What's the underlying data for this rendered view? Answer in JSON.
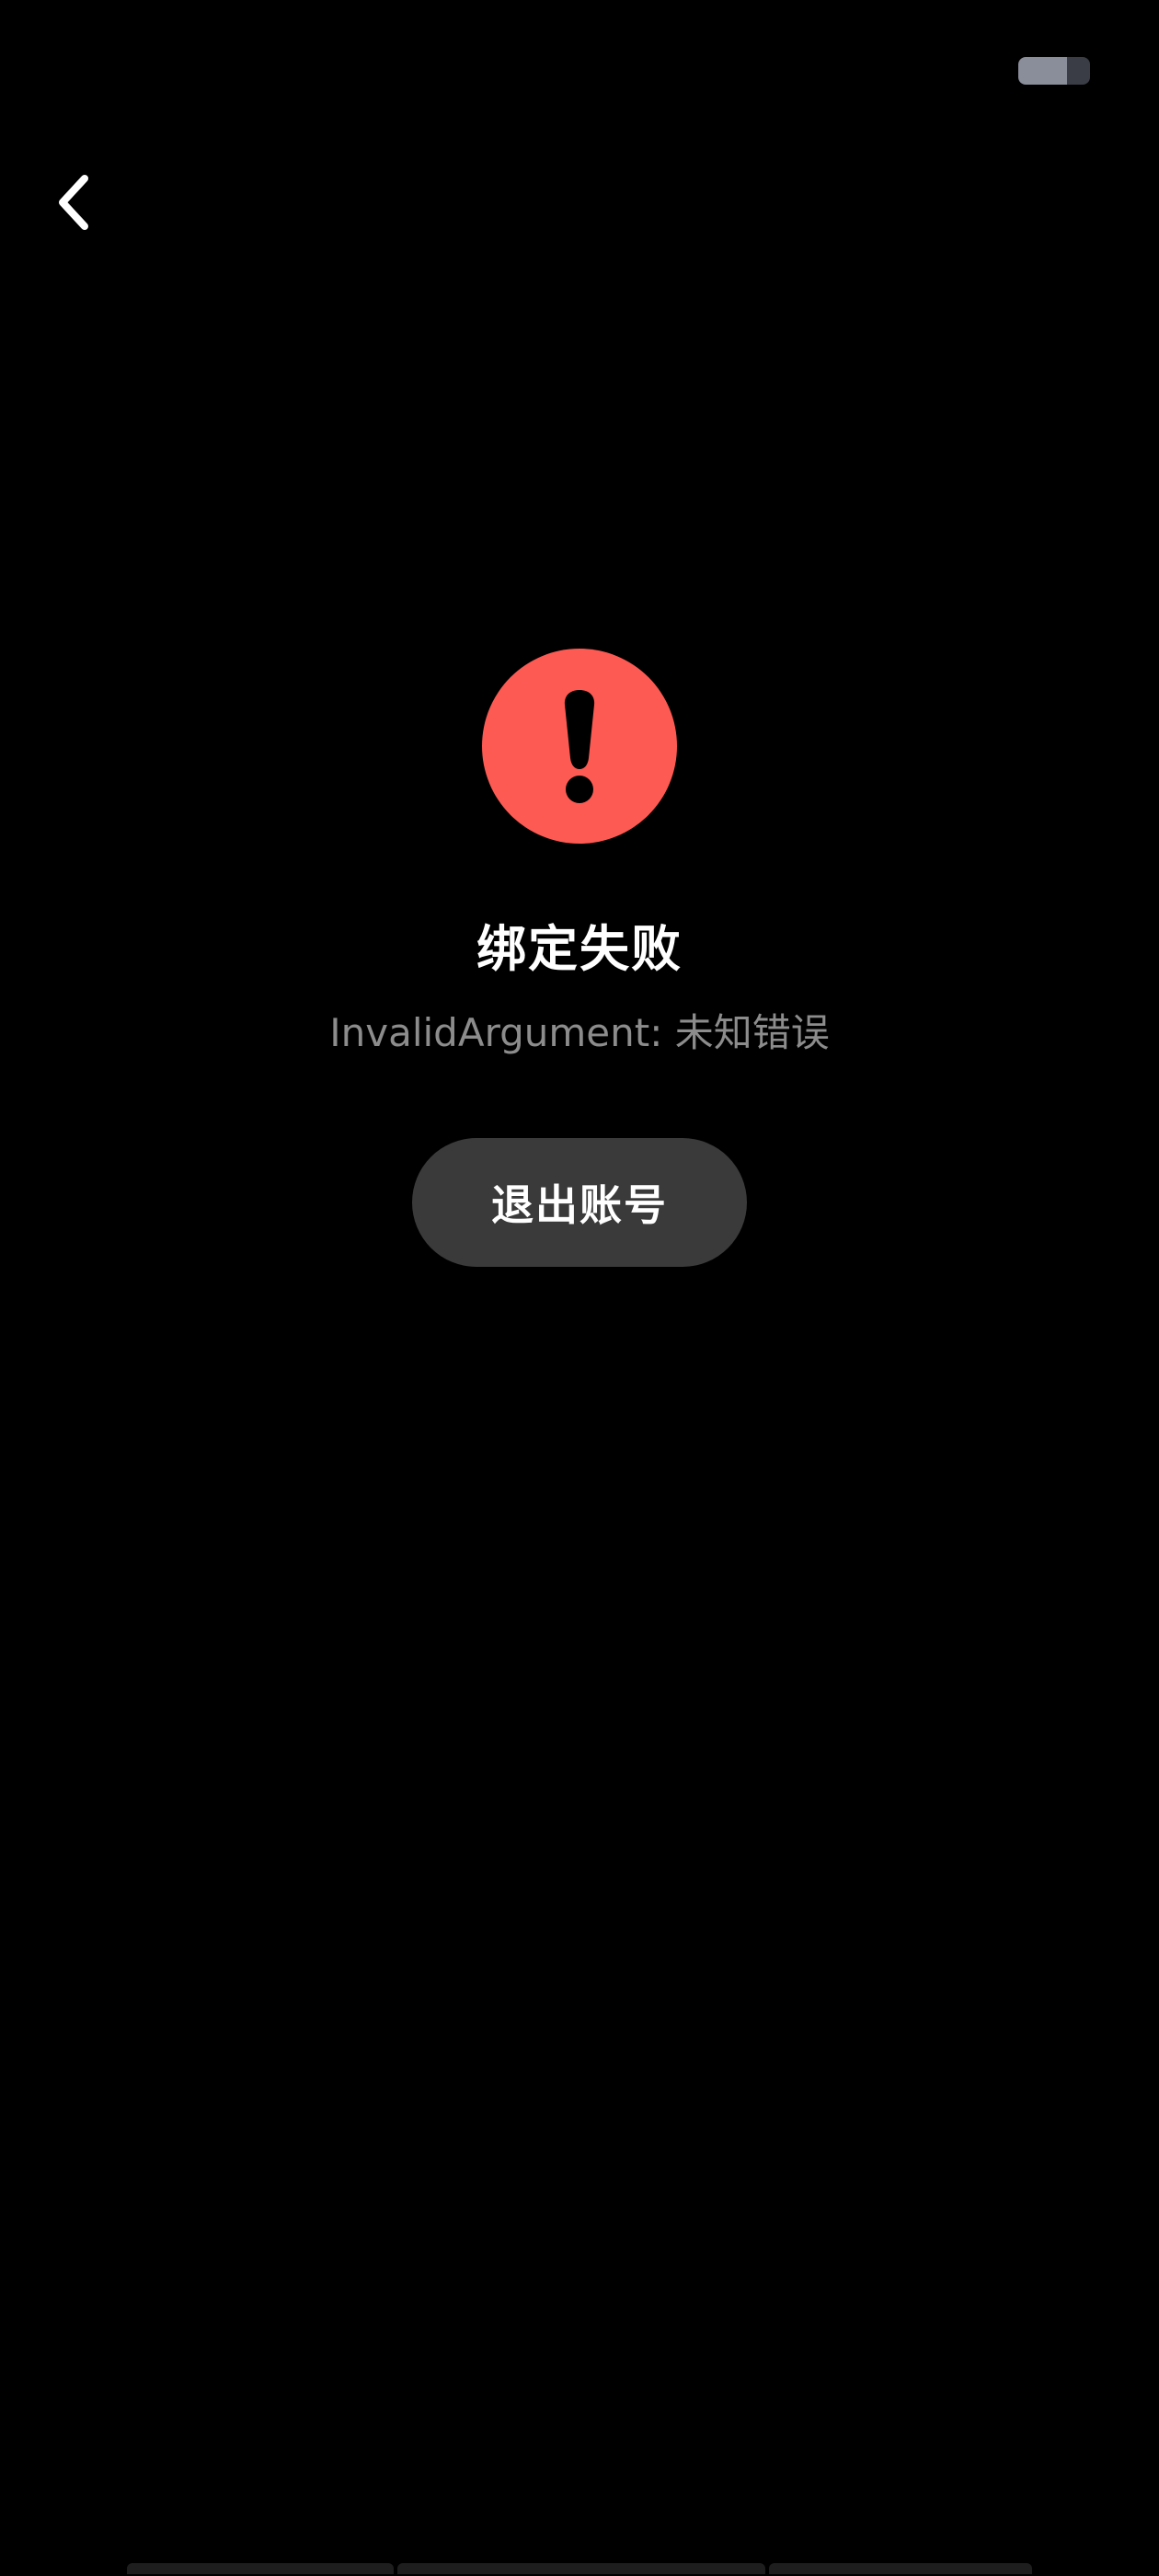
{
  "colors": {
    "background": "#000000",
    "error_badge": "#fc5a52",
    "button_background": "#3a3a3a",
    "subtitle_text": "#8c8c8c"
  },
  "status_bar": {
    "battery_icon": "battery-icon",
    "battery_level": 0.68
  },
  "nav": {
    "back_icon": "chevron-left-icon"
  },
  "result": {
    "icon": "exclamation-icon",
    "title": "绑定失败",
    "message": "InvalidArgument: 未知错误",
    "logout_label": "退出账号"
  }
}
